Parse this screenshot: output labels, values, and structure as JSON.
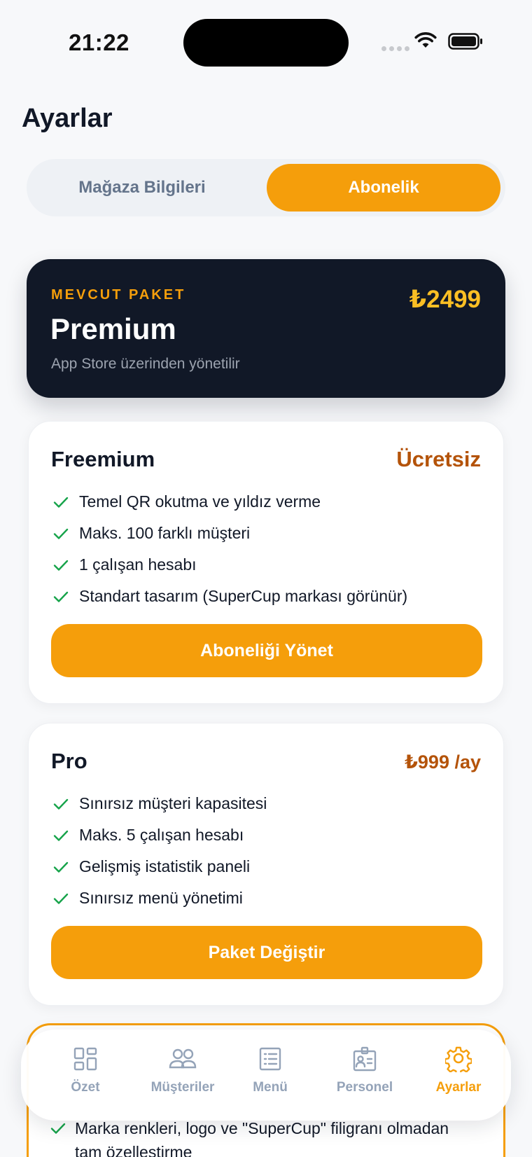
{
  "status": {
    "time": "21:22"
  },
  "page": {
    "title": "Ayarlar"
  },
  "segments": {
    "store": "Mağaza Bilgileri",
    "subscription": "Abonelik"
  },
  "current_plan": {
    "label": "MEVCUT PAKET",
    "name": "Premium",
    "note": "App Store üzerinden yönetilir",
    "price": "₺2499"
  },
  "plans": [
    {
      "name": "Freemium",
      "price": "Ücretsiz",
      "features": [
        "Temel QR okutma ve yıldız verme",
        "Maks. 100 farklı müşteri",
        "1 çalışan hesabı",
        "Standart tasarım (SuperCup markası görünür)"
      ],
      "button": "Aboneliği Yönet"
    },
    {
      "name": "Pro",
      "price": "₺999 /ay",
      "features": [
        "Sınırsız müşteri kapasitesi",
        "Maks. 5 çalışan hesabı",
        "Gelişmiş istatistik paneli",
        "Sınırsız menü yönetimi"
      ],
      "button": "Paket Değiştir"
    }
  ],
  "premium_partial": {
    "feature": "Marka renkleri, logo ve \"SuperCup\" filigranı olmadan tam özelleştirme"
  },
  "tabbar": [
    {
      "label": "Özet",
      "icon": "dashboard-icon"
    },
    {
      "label": "Müşteriler",
      "icon": "users-icon"
    },
    {
      "label": "Menü",
      "icon": "list-icon"
    },
    {
      "label": "Personel",
      "icon": "badge-icon"
    },
    {
      "label": "Ayarlar",
      "icon": "gear-icon",
      "active": true
    }
  ],
  "colors": {
    "accent": "#f59e0b",
    "dark_card": "#111827",
    "price_brown": "#b45309",
    "check_green": "#16a34a",
    "muted": "#94a3b8"
  }
}
